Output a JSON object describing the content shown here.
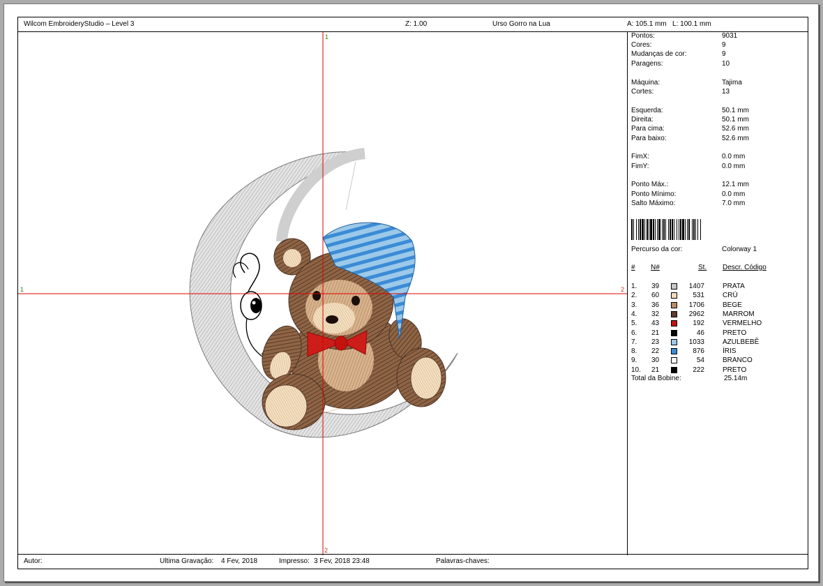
{
  "header": {
    "app_title": "Wilcom EmbroideryStudio – Level 3",
    "zoom": "Z: 1.00",
    "design_name": "Urso Gorro na Lua",
    "dimensions": "A: 105.1 mm   L: 100.1 mm"
  },
  "axis_labels": {
    "top": "1",
    "left": "1",
    "right": "2",
    "bottom": "2"
  },
  "stats": {
    "pontos": {
      "label": "Pontos:",
      "value": "9031"
    },
    "cores": {
      "label": "Cores:",
      "value": "9"
    },
    "mudancas": {
      "label": "Mudanças de cor:",
      "value": "9"
    },
    "paragens": {
      "label": "Paragens:",
      "value": "10"
    },
    "maquina": {
      "label": "Máquina:",
      "value": "Tajima"
    },
    "cortes": {
      "label": "Cortes:",
      "value": "13"
    },
    "esquerda": {
      "label": "Esquerda:",
      "value": "50.1 mm"
    },
    "direita": {
      "label": "Direita:",
      "value": "50.1 mm"
    },
    "para_cima": {
      "label": "Para cima:",
      "value": "52.6 mm"
    },
    "para_baixo": {
      "label": "Para baixo:",
      "value": "52.6 mm"
    },
    "fimx": {
      "label": "FimX:",
      "value": "0.0 mm"
    },
    "fimy": {
      "label": "FimY:",
      "value": "0.0 mm"
    },
    "ponto_max": {
      "label": "Ponto Máx.:",
      "value": "12.1 mm"
    },
    "ponto_min": {
      "label": "Ponto Mínimo:",
      "value": "0.0 mm"
    },
    "salto_max": {
      "label": "Salto Máximo:",
      "value": "7.0 mm"
    }
  },
  "percurso": {
    "label": "Percurso da cor:",
    "value": "Colorway 1"
  },
  "color_table": {
    "headers": {
      "num": "#",
      "n": "N#",
      "st": "St.",
      "desc": "Descr. Código"
    },
    "rows": [
      {
        "idx": "1.",
        "n": "39",
        "color": "#c8c8c8",
        "st": "1407",
        "name": "PRATA"
      },
      {
        "idx": "2.",
        "n": "60",
        "color": "#f2dcb8",
        "st": "531",
        "name": "CRÚ"
      },
      {
        "idx": "3.",
        "n": "36",
        "color": "#b98d62",
        "st": "1706",
        "name": "BEGE"
      },
      {
        "idx": "4.",
        "n": "32",
        "color": "#5c3d2e",
        "st": "2962",
        "name": "MARROM"
      },
      {
        "idx": "5.",
        "n": "43",
        "color": "#c4120f",
        "st": "192",
        "name": "VERMELHO"
      },
      {
        "idx": "6.",
        "n": "21",
        "color": "#000000",
        "st": "46",
        "name": "PRETO"
      },
      {
        "idx": "7.",
        "n": "23",
        "color": "#9cc9ea",
        "st": "1033",
        "name": "AZULBEBÊ"
      },
      {
        "idx": "8.",
        "n": "22",
        "color": "#3b8bd6",
        "st": "876",
        "name": "ÍRIS"
      },
      {
        "idx": "9.",
        "n": "30",
        "color": "#ffffff",
        "st": "54",
        "name": "BRANCO"
      },
      {
        "idx": "10.",
        "n": "21",
        "color": "#000000",
        "st": "222",
        "name": "PRETO"
      }
    ],
    "total_label": "Total da Bobine:",
    "total_value": "25.14m"
  },
  "footer": {
    "autor": "Autor:",
    "ultima_label": "Ultima Gravação:",
    "ultima_value": "4 Fev, 2018",
    "impresso_label": "Impresso:",
    "impresso_value": "3 Fev, 2018 23:48",
    "palavras": "Palavras-chaves:"
  },
  "colors": {
    "crosshair": "#e00000",
    "axis_label_green": "#1d8a1d",
    "page_background": "#ababab"
  }
}
